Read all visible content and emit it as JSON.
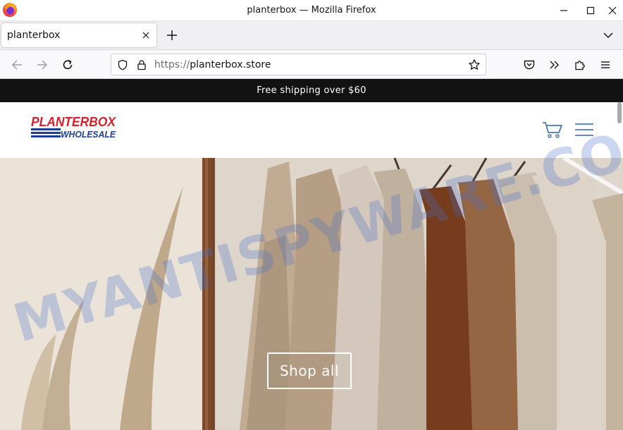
{
  "window": {
    "title": "planterbox — Mozilla Firefox"
  },
  "tabs": [
    {
      "label": "planterbox",
      "active": true
    }
  ],
  "urlbar": {
    "scheme": "https://",
    "host": "planterbox.store"
  },
  "page": {
    "announcement": "Free shipping over $60",
    "logo": {
      "line1": "PLANTERBOX",
      "line2": "WHOLESALE",
      "colors": {
        "red": "#d4202a",
        "blue": "#1b3f93"
      }
    },
    "header_icons": [
      "cart-icon",
      "menu-icon"
    ],
    "hero": {
      "button_label": "Shop all"
    },
    "accent_color": "#4a7ab5"
  },
  "watermark": "MYANTISPYWARE.COM"
}
